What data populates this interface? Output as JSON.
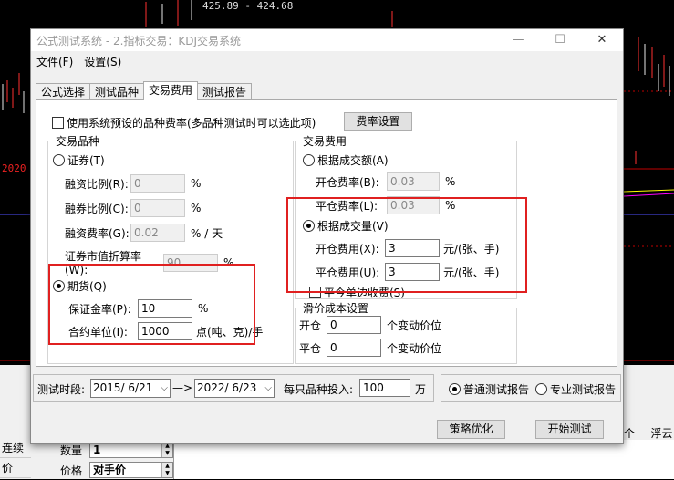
{
  "background": {
    "quote_text": "425.89 - 424.68",
    "year_label": "2020",
    "left_items": [
      "连续",
      "价"
    ],
    "trade_rows": [
      {
        "label": "数量",
        "value": "1"
      },
      {
        "label": "价格",
        "value": "对手价"
      }
    ],
    "right_header": [
      "个",
      "浮云"
    ]
  },
  "window": {
    "title": "公式测试系统 - 2.指标交易：KDJ交易系统",
    "controls": {
      "minimize": "—",
      "maximize": "☐",
      "close": "✕"
    }
  },
  "menu": [
    "文件(F)",
    "设置(S)"
  ],
  "tabs": [
    "公式选择",
    "测试品种",
    "交易费用",
    "测试报告"
  ],
  "active_tab": 2,
  "fee_settings": {
    "use_preset_label": "使用系统预设的品种费率(多品种测试时可以选此项)",
    "use_preset_checked": false,
    "rate_button": "费率设置"
  },
  "trade_variety": {
    "title": "交易品种",
    "securities_label": "证券(T)",
    "securities_selected": false,
    "sec_fields": [
      {
        "label": "融资比例(R):",
        "value": "0",
        "unit": "%"
      },
      {
        "label": "融券比例(C):",
        "value": "0",
        "unit": "%"
      },
      {
        "label": "融资费率(G):",
        "value": "0.02",
        "unit": "% / 天"
      },
      {
        "label": "证券市值折算率(W):",
        "value": "90",
        "unit": "%"
      }
    ],
    "futures_label": "期货(Q)",
    "futures_selected": true,
    "fut_fields": [
      {
        "label": "保证金率(P):",
        "value": "10",
        "unit": "%"
      },
      {
        "label": "合约单位(I):",
        "value": "1000",
        "unit": "点(吨、克)/手"
      }
    ]
  },
  "trade_fee": {
    "title": "交易费用",
    "by_amount_label": "根据成交额(A)",
    "by_amount_selected": false,
    "amount_fields": [
      {
        "label": "开仓费率(B):",
        "value": "0.03",
        "unit": "%"
      },
      {
        "label": "平仓费率(L):",
        "value": "0.03",
        "unit": "%"
      }
    ],
    "by_volume_label": "根据成交量(V)",
    "by_volume_selected": true,
    "volume_fields": [
      {
        "label": "开仓费用(X):",
        "value": "3",
        "unit": "元/(张、手)"
      },
      {
        "label": "平仓费用(U):",
        "value": "3",
        "unit": "元/(张、手)"
      }
    ],
    "single_side_label": "平今单边收费(S)",
    "single_side_checked": false
  },
  "slippage": {
    "title": "滑价成本设置",
    "rows": [
      {
        "label": "开仓",
        "value": "0",
        "unit": "个变动价位"
      },
      {
        "label": "平仓",
        "value": "0",
        "unit": "个变动价位"
      }
    ]
  },
  "test_period": {
    "label": "测试时段:",
    "start": "2015/ 6/21",
    "arrow": "—>",
    "end": "2022/ 6/23",
    "invest_label": "每只品种投入:",
    "invest_value": "100",
    "invest_unit": "万"
  },
  "report_type": {
    "normal_label": "普通测试报告",
    "normal_selected": true,
    "pro_label": "专业测试报告",
    "pro_selected": false
  },
  "actions": {
    "optimize": "策略优化",
    "start": "开始测试"
  },
  "colors": {
    "highlight_box": "#e02020"
  }
}
